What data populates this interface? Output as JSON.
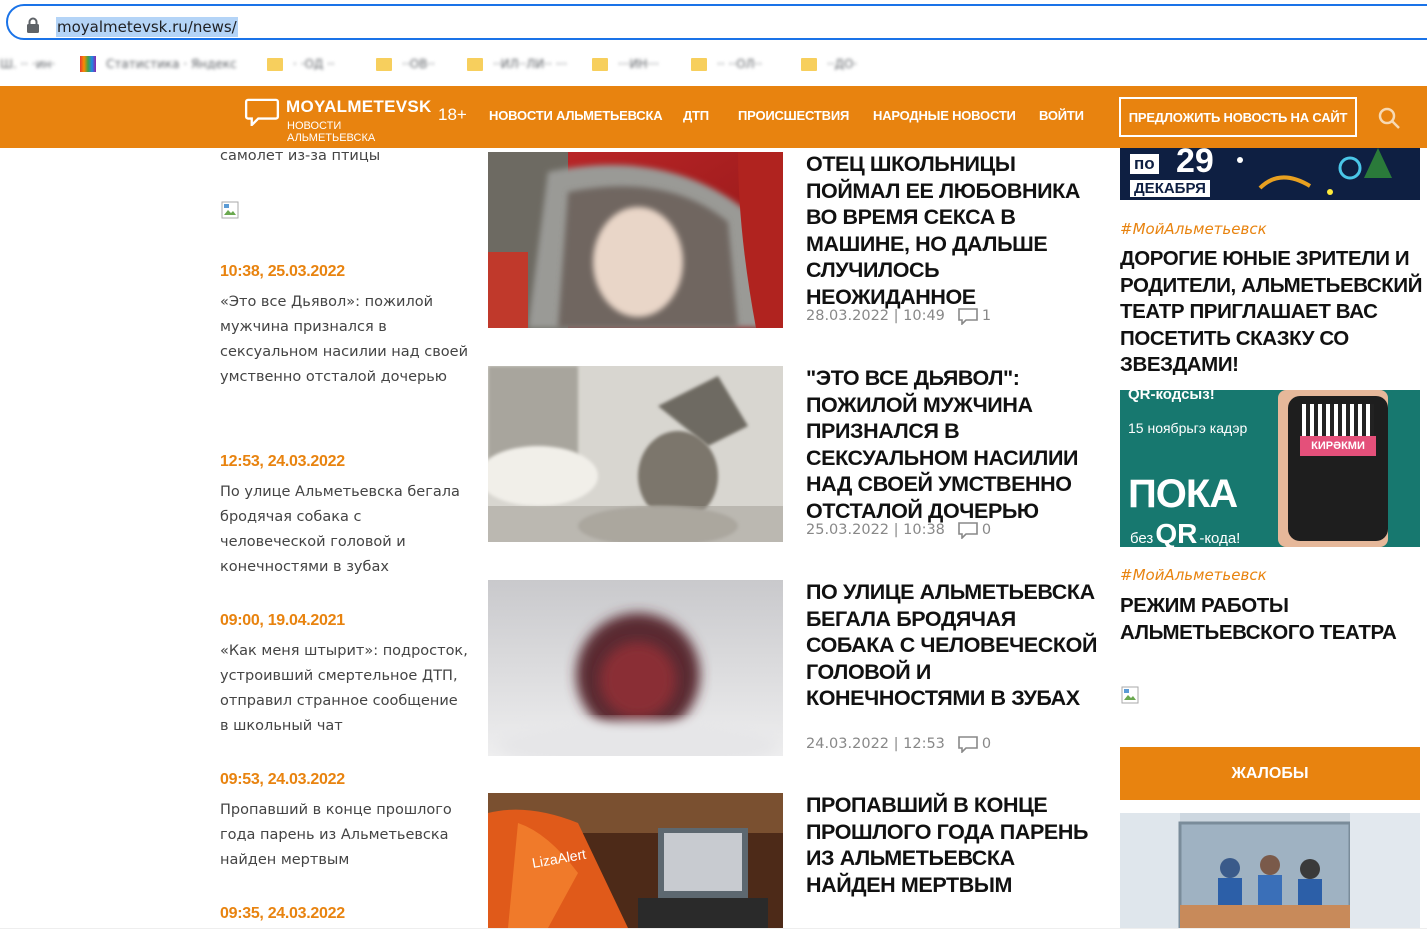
{
  "browser": {
    "url": "moyalmetevsk.ru/news/",
    "bookmarks": [
      "Ш. ·· ·ин·",
      "Статистика · Яндекс",
      "· ·ОД ··",
      "··ОВ··",
      "··ИЛ··ЛИ·· ···",
      "···ИН···",
      "·· ··ОЛ··",
      "··ДО·"
    ]
  },
  "header": {
    "logo_title": "MOYALMETEVSK",
    "logo_subtitle": "НОВОСТИ АЛЬМЕТЬЕВСКА",
    "age_rating": "18+",
    "nav": [
      "НОВОСТИ АЛЬМЕТЬЕВСКА",
      "ДТП",
      "ПРОИСШЕСТВИЯ",
      "НАРОДНЫЕ НОВОСТИ",
      "ВОЙТИ"
    ],
    "suggest_button": "ПРЕДЛОЖИТЬ НОВОСТЬ НА САЙТ"
  },
  "sidebar_news": {
    "partial_top": "самолет из-за птицы",
    "items": [
      {
        "date": "10:38, 25.03.2022",
        "text": "«Это все Дьявол»: пожилой мужчина признался в сексуальном насилии над своей умственно отсталой дочерью"
      },
      {
        "date": "12:53, 24.03.2022",
        "text": "По улице Альметьевска бегала бродячая собака с человеческой головой и конечностями в зубах"
      },
      {
        "date": "09:00, 19.04.2021",
        "text": "«Как меня штырит»: подросток, устроивший смертельное ДТП, отправил странное сообщение в школьный чат"
      },
      {
        "date": "09:53, 24.03.2022",
        "text": "Пропавший в конце прошлого года парень из Альметьевска найден мертвым"
      },
      {
        "date": "09:35, 24.03.2022",
        "text": ""
      }
    ]
  },
  "main_news": [
    {
      "title": "ОТЕЦ ШКОЛЬНИЦЫ ПОЙМАЛ ЕЕ ЛЮБОВНИКА ВО ВРЕМЯ СЕКСА В МАШИНЕ, НО ДАЛЬШЕ СЛУЧИЛОСЬ НЕОЖИДАННОЕ",
      "date": "28.03.2022 | 10:49",
      "comments": "1"
    },
    {
      "title": "\"ЭТО ВСЕ ДЬЯВОЛ\": ПОЖИЛОЙ МУЖЧИНА ПРИЗНАЛСЯ В СЕКСУАЛЬНОМ НАСИЛИИ НАД СВОЕЙ УМСТВЕННО ОТСТАЛОЙ ДОЧЕРЬЮ",
      "date": "25.03.2022 | 10:38",
      "comments": "0"
    },
    {
      "title": "ПО УЛИЦЕ АЛЬМЕТЬЕВСКА БЕГАЛА БРОДЯЧАЯ СОБАКА С ЧЕЛОВЕЧЕСКОЙ ГОЛОВОЙ И КОНЕЧНОСТЯМИ В ЗУБАХ",
      "date": "24.03.2022 | 12:53",
      "comments": "0"
    },
    {
      "title": "ПРОПАВШИЙ В КОНЦЕ ПРОШЛОГО ГОДА ПАРЕНЬ ИЗ АЛЬМЕТЬЕВСКА НАЙДЕН МЕРТВЫМ",
      "date": "",
      "comments": ""
    }
  ],
  "right_column": {
    "banner1": {
      "text_top": "по",
      "number": "29",
      "text_bottom": "ДЕКАБРЯ"
    },
    "item1": {
      "tag": "#МойАльметьевск",
      "title": "ДОРОГИЕ ЮНЫЕ ЗРИТЕЛИ И РОДИТЕЛИ, АЛЬМЕТЬЕВСКИЙ ТЕАТР ПРИГЛАШАЕТ ВАС ПОСЕТИТЬ СКАЗКУ СО ЗВЕЗДАМИ!"
    },
    "banner2": {
      "line1": "QR-кодсыз!",
      "line2": "15 ноябрьгэ кадэр",
      "line3": "ПОКА",
      "line4a": "без",
      "line4b": "QR",
      "line4c": "-кода!",
      "phone_label": "КИРӘКМИ"
    },
    "item2": {
      "tag": "#МойАльметьевск",
      "title": "РЕЖИМ РАБОТЫ АЛЬМЕТЬЕВСКОГО ТЕАТРА"
    },
    "complaints_button": "ЖАЛОБЫ"
  },
  "colors": {
    "brand_orange": "#e8830f",
    "text_dark": "#111111",
    "meta_gray": "#888888"
  }
}
